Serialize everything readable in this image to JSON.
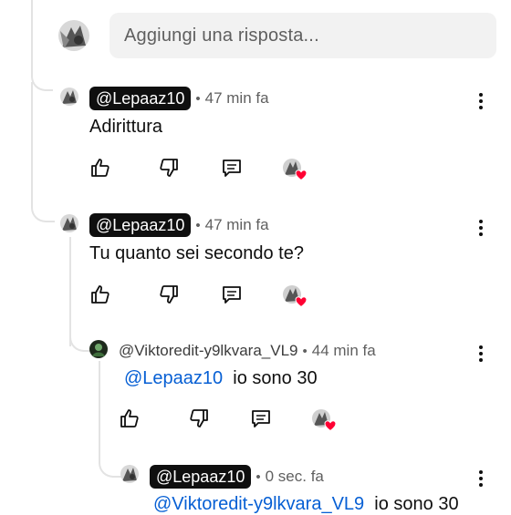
{
  "reply_input": {
    "placeholder": "Aggiungi una risposta..."
  },
  "comments": [
    {
      "handle": "@Lepaaz10",
      "separator": "•",
      "time": "47 min fa",
      "text": "Adirittura"
    },
    {
      "handle": "@Lepaaz10",
      "separator": "•",
      "time": "47 min fa",
      "text": "Tu quanto sei secondo te?"
    },
    {
      "handle": "@Viktoredit-y9lkvara_VL9",
      "separator": "•",
      "time": "44 min fa",
      "mention": "@Lepaaz10",
      "text": "io sono 30"
    },
    {
      "handle": "@Lepaaz10",
      "separator": "•",
      "time": "0 sec. fa",
      "mention": "@Viktoredit-y9lkvara_VL9",
      "text": "io sono 30"
    }
  ],
  "icons": {
    "like": "thumbs-up-icon",
    "dislike": "thumbs-down-icon",
    "reply": "reply-comment-icon",
    "creator_heart": "creator-heart-icon",
    "more": "more-vert-icon"
  },
  "colors": {
    "mention": "#065fd4",
    "heart": "#ff0033",
    "input_bg": "#f2f2f2",
    "chip_bg": "#0f0f0f"
  }
}
